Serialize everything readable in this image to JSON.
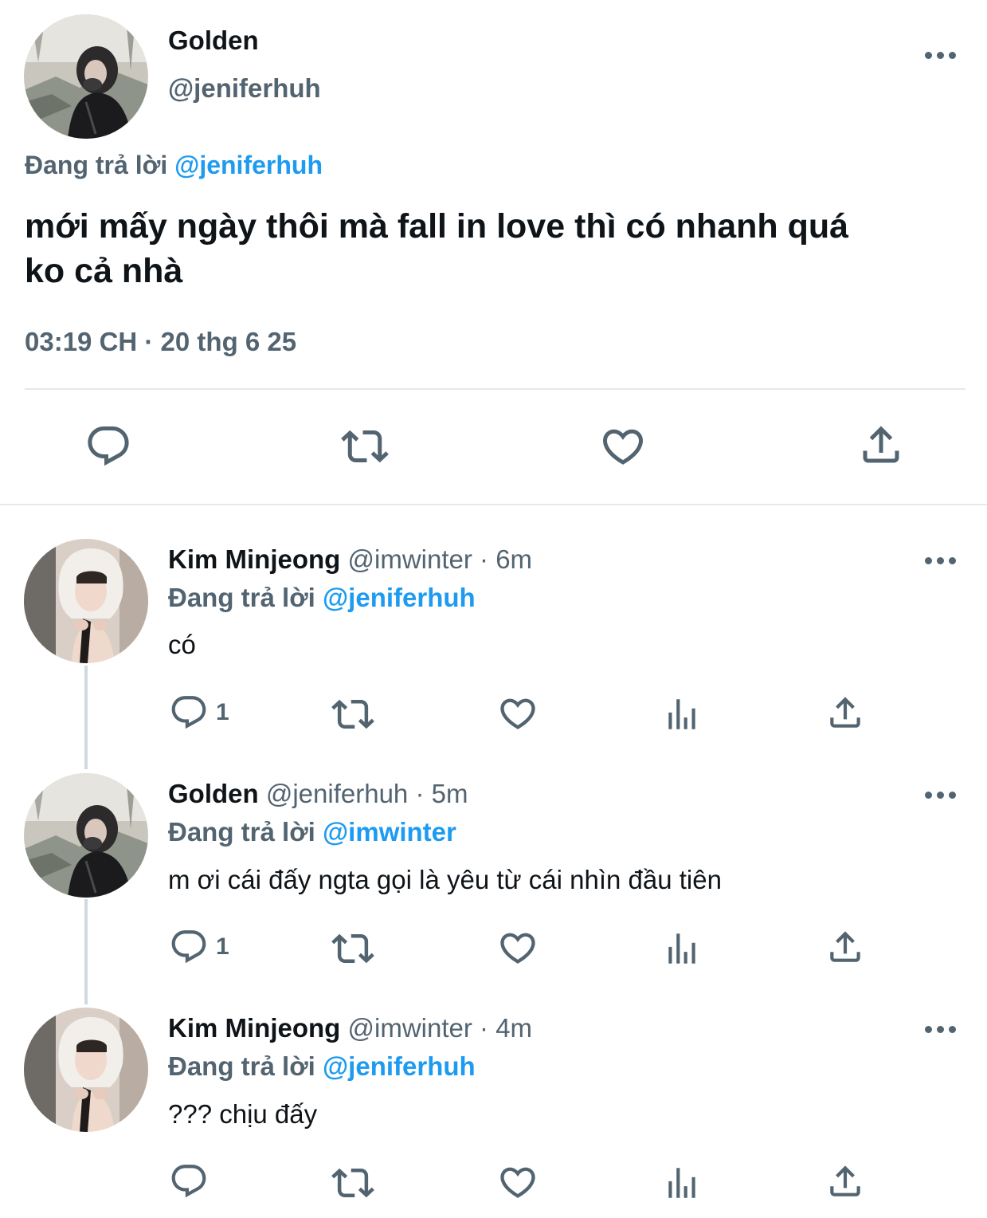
{
  "main_tweet": {
    "display_name": "Golden",
    "handle": "@jeniferhuh",
    "reply_prefix": "Đang trả lời",
    "reply_to": "@jeniferhuh",
    "text_line1": "mới mấy ngày thôi mà fall in love thì có nhanh quá",
    "text_line2": "ko cả nhà",
    "timestamp": "03:19 CH · 20 thg 6 25"
  },
  "replies": [
    {
      "display_name": "Kim Minjeong",
      "handle": "@imwinter",
      "time": "· 6m",
      "reply_prefix": "Đang trả lời",
      "reply_to": "@jeniferhuh",
      "text": "có",
      "reply_count": "1"
    },
    {
      "display_name": "Golden",
      "handle": "@jeniferhuh",
      "time": "· 5m",
      "reply_prefix": "Đang trả lời",
      "reply_to": "@imwinter",
      "text": "m ơi cái đấy ngta gọi là yêu từ cái nhìn đầu tiên",
      "reply_count": "1"
    },
    {
      "display_name": "Kim Minjeong",
      "handle": "@imwinter",
      "time": "· 4m",
      "reply_prefix": "Đang trả lời",
      "reply_to": "@jeniferhuh",
      "text": "??? chịu đấy",
      "reply_count": ""
    }
  ],
  "icons": {
    "reply": "reply-icon",
    "retweet": "retweet-icon",
    "like": "like-icon",
    "views": "views-icon",
    "share": "share-icon",
    "more": "more-icon"
  },
  "colors": {
    "link_blue": "#1d9bf0",
    "secondary_text": "#536471",
    "divider": "#e6e9eb"
  }
}
